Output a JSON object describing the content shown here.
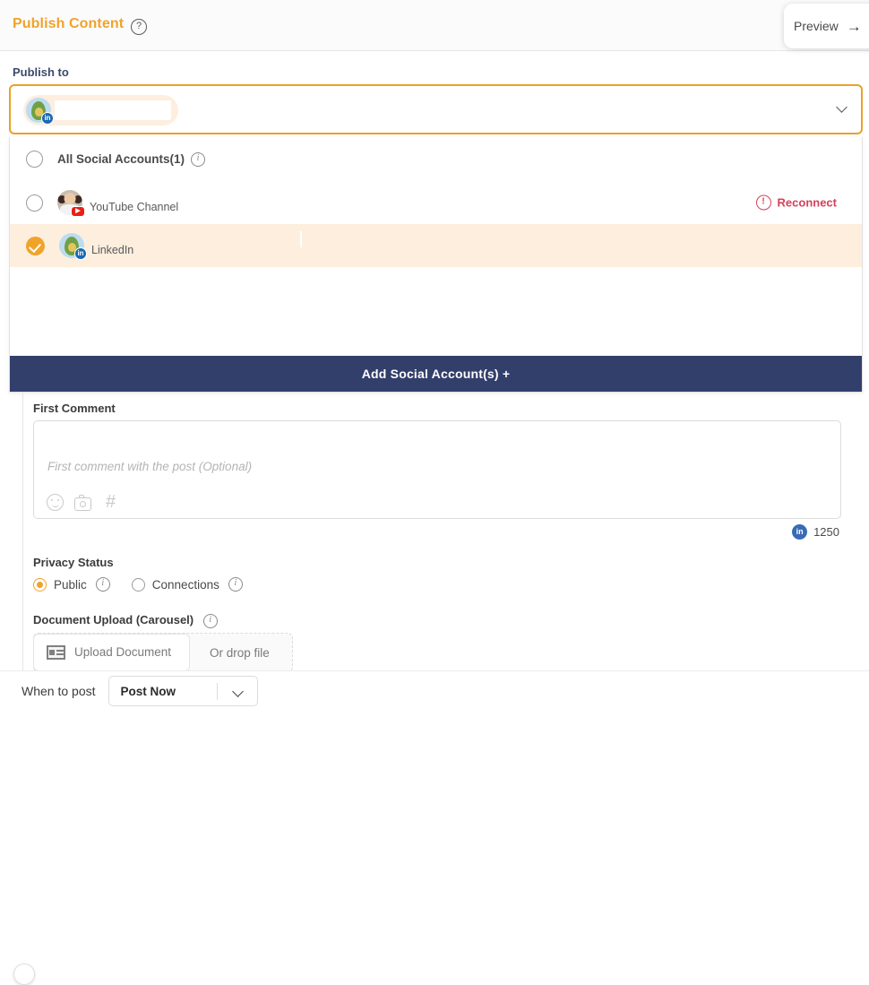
{
  "header": {
    "title": "Publish Content",
    "help_icon": "question-circle-icon",
    "preview_label": "Preview",
    "preview_arrow": "→"
  },
  "publish_to": {
    "label": "Publish to",
    "selected_chip": {
      "avatar": "avocado-avatar",
      "badge": "linkedin-badge",
      "name_redacted": true
    },
    "caret_icon": "chevron-down-icon"
  },
  "dropdown": {
    "options": [
      {
        "label": "All Social Accounts(1)",
        "selected": false,
        "info_icon": "info-icon",
        "type": "all"
      },
      {
        "label": "YouTube Channel",
        "selected": false,
        "avatar": "portrait-avatar",
        "badge": "youtube-badge",
        "status_label": "Reconnect",
        "status_icon": "warning-circle-icon",
        "status_color": "#d4415a",
        "type": "account"
      },
      {
        "label": "LinkedIn",
        "selected": true,
        "avatar": "avocado-avatar",
        "badge": "linkedin-badge",
        "check_icon": "check-circle-icon",
        "type": "account"
      }
    ],
    "add_account_label": "Add Social Account(s)  +"
  },
  "first_comment": {
    "label": "First Comment",
    "placeholder": "First comment with the post (Optional)",
    "value": "",
    "tools": [
      {
        "icon": "emoji-icon"
      },
      {
        "icon": "camera-icon"
      },
      {
        "icon": "hashtag-icon"
      }
    ],
    "counter": {
      "platform_icon": "linkedin-icon",
      "platform_initials": "in",
      "count": "1250"
    }
  },
  "privacy": {
    "label": "Privacy Status",
    "options": [
      {
        "label": "Public",
        "selected": true,
        "info_icon": "info-icon"
      },
      {
        "label": "Connections",
        "selected": false,
        "info_icon": "info-icon"
      }
    ]
  },
  "document_upload": {
    "label": "Document Upload (Carousel)",
    "info_icon": "info-icon",
    "button_label": "Upload Document",
    "button_icon": "document-icon",
    "drop_text": "Or drop file"
  },
  "footer": {
    "when_label": "When to post",
    "when_value": "Post Now",
    "caret_icon": "chevron-down-icon"
  },
  "colors": {
    "accent_orange": "#f0a32a",
    "navy": "#333f6b",
    "danger_red": "#d4415a",
    "linkedin_blue": "#1a68b5",
    "selected_row_bg": "#fdeede"
  }
}
